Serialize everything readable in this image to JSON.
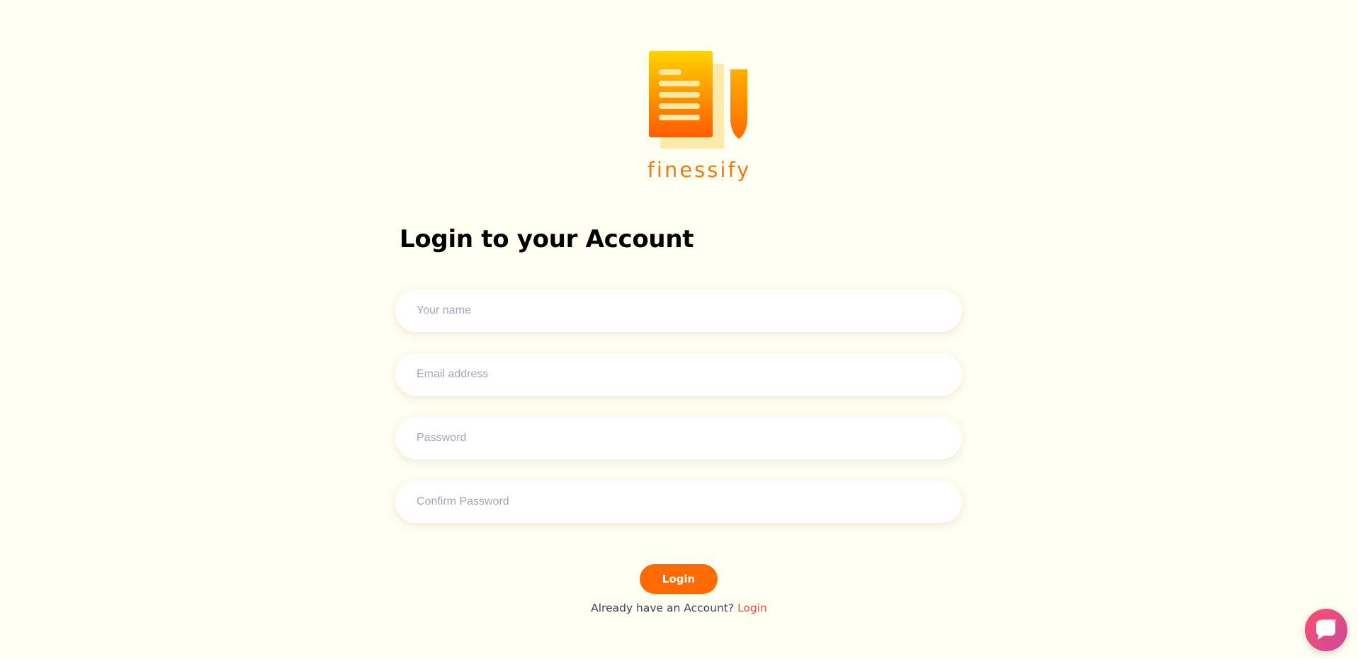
{
  "brand": {
    "name": "finessify",
    "color_primary": "#ff6a00",
    "color_logo_top": "#ffd400",
    "color_logo_bottom": "#ff5a00",
    "color_logo_shadow": "#fde9a8"
  },
  "form": {
    "title": "Login to your Account",
    "fields": [
      {
        "placeholder": "Your name",
        "value": ""
      },
      {
        "placeholder": "Email address",
        "value": ""
      },
      {
        "placeholder": "Password",
        "value": ""
      },
      {
        "placeholder": "Confirm Password",
        "value": ""
      }
    ],
    "submit_label": "Login",
    "footer_text": "Already have an Account?",
    "footer_link": "Login",
    "footer_link_color": "#f04a4a"
  },
  "chat": {
    "icon": "chat-bubble-icon",
    "gradient_start": "#ff4d6d",
    "gradient_end": "#c94a9e"
  },
  "background_color": "#fffff2"
}
